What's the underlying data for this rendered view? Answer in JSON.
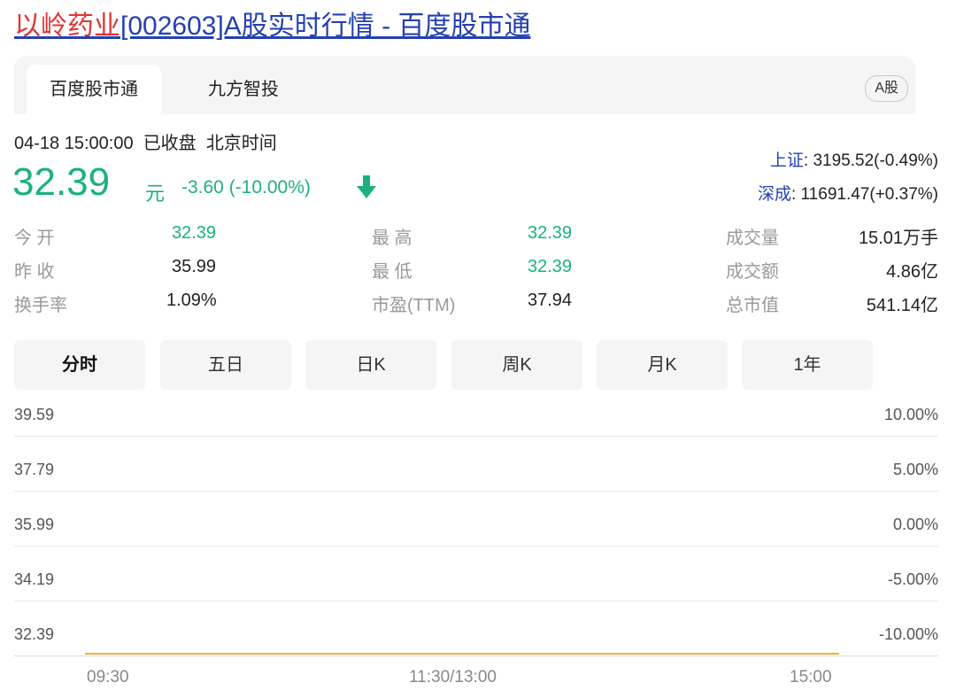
{
  "title": {
    "name": "以岭药业",
    "rest": "[002603]A股实时行情 - 百度股市通"
  },
  "tabs": [
    {
      "label": "百度股市通",
      "active": true
    },
    {
      "label": "九方智投",
      "active": false
    }
  ],
  "market_badge": "A股",
  "status": {
    "datetime": "04-18 15:00:00",
    "state": "已收盘",
    "timezone": "北京时间"
  },
  "quote": {
    "price": "32.39",
    "unit": "元",
    "change": "-3.60 (-10.00%)",
    "direction": "down",
    "color": "#1bb17f"
  },
  "indices": [
    {
      "label": "上证",
      "value": ": 3195.52(-0.49%)"
    },
    {
      "label": "深成",
      "value": ": 11691.47(+0.37%)"
    }
  ],
  "stats": [
    {
      "label": "今 开",
      "value": "32.39",
      "green": true
    },
    {
      "label": "最 高",
      "value": "32.39",
      "green": true
    },
    {
      "label": "成交量",
      "value": "15.01万手",
      "green": false
    },
    {
      "label": "昨 收",
      "value": "35.99",
      "green": false
    },
    {
      "label": "最 低",
      "value": "32.39",
      "green": true
    },
    {
      "label": "成交额",
      "value": "4.86亿",
      "green": false
    },
    {
      "label": "换手率",
      "value": "1.09%",
      "green": false
    },
    {
      "label": "市盈(TTM)",
      "value": "37.94",
      "green": false
    },
    {
      "label": "总市值",
      "value": "541.14亿",
      "green": false
    }
  ],
  "period_tabs": [
    {
      "label": "分时",
      "active": true
    },
    {
      "label": "五日",
      "active": false
    },
    {
      "label": "日K",
      "active": false
    },
    {
      "label": "周K",
      "active": false
    },
    {
      "label": "月K",
      "active": false
    },
    {
      "label": "1年",
      "active": false
    }
  ],
  "chart": {
    "price_ticks": [
      "39.59",
      "37.79",
      "35.99",
      "34.19",
      "32.39"
    ],
    "pct_ticks": [
      "10.00%",
      "5.00%",
      "0.00%",
      "-5.00%",
      "-10.00%"
    ],
    "time_ticks": [
      "09:30",
      "11:30/13:00",
      "15:00"
    ],
    "line_color": "#e6b53c",
    "price_level": "32.39"
  }
}
